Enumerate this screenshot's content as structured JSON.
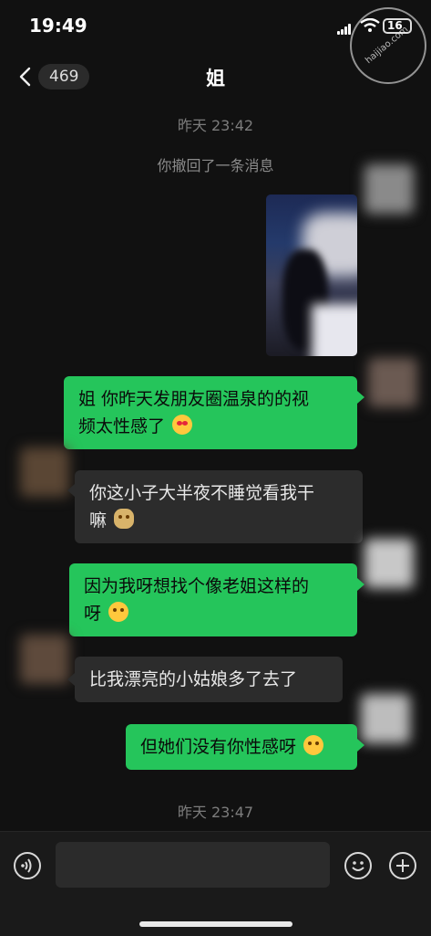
{
  "status_bar": {
    "time": "19:49",
    "battery": "16",
    "watermark_text": "haijiao.com"
  },
  "nav": {
    "back_count": "469",
    "title": "姐"
  },
  "chat": {
    "time_top": "昨天 23:42",
    "recall_notice": "你撤回了一条消息",
    "messages": [
      {
        "side": "me",
        "type": "image",
        "label": ""
      },
      {
        "side": "me",
        "line1": "姐 你昨天发朋友圈温泉的的视",
        "line2": "频太性感了",
        "emoji": "heart-eyes-face-icon"
      },
      {
        "side": "other",
        "line1": "你这小子大半夜不睡觉看我干",
        "line2": "嘛",
        "emoji": "bear-face-icon"
      },
      {
        "side": "me",
        "line1": "因为我呀想找个像老姐这样的",
        "line2": "呀",
        "emoji": "kissing-face-icon"
      },
      {
        "side": "other",
        "line1": "比我漂亮的小姑娘多了去了"
      },
      {
        "side": "me",
        "line1": "但她们没有你性感呀",
        "emoji": "winking-tongue-face-icon"
      }
    ],
    "time_bottom": "昨天 23:47"
  },
  "input_bar": {
    "placeholder": "",
    "value": ""
  },
  "colors": {
    "me_bubble": "#25c55b",
    "other_bubble": "#2c2c2c",
    "background": "#111111"
  }
}
